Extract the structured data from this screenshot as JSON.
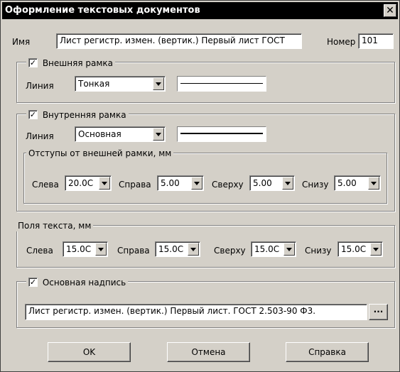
{
  "window": {
    "title": "Оформление текстовых документов",
    "close_glyph": "✕"
  },
  "name_row": {
    "name_label": "Имя",
    "name_value": "Лист регистр. измен. (вертик.) Первый лист ГОСТ",
    "number_label": "Номер",
    "number_value": "101"
  },
  "outer_frame": {
    "checkbox_label": "Внешняя рамка",
    "checked": true,
    "line_label": "Линия",
    "line_value": "Тонкая"
  },
  "inner_frame": {
    "checkbox_label": "Внутренняя рамка",
    "checked": true,
    "line_label": "Линия",
    "line_value": "Основная",
    "offsets": {
      "title": "Отступы от внешней рамки, мм",
      "left_label": "Слева",
      "left_value": "20.0С",
      "right_label": "Справа",
      "right_value": "5.00",
      "top_label": "Сверху",
      "top_value": "5.00",
      "bottom_label": "Снизу",
      "bottom_value": "5.00"
    }
  },
  "text_margins": {
    "title": "Поля текста, мм",
    "left_label": "Слева",
    "left_value": "15.0С",
    "right_label": "Справа",
    "right_value": "15.0С",
    "top_label": "Сверху",
    "top_value": "15.0С",
    "bottom_label": "Снизу",
    "bottom_value": "15.0С"
  },
  "main_inscription": {
    "checkbox_label": "Основная надпись",
    "checked": true,
    "value": "Лист регистр. измен. (вертик.) Первый лист. ГОСТ 2.503-90 Ф3.",
    "browse_label": "···"
  },
  "buttons": {
    "ok": "OK",
    "cancel": "Отмена",
    "help": "Справка"
  },
  "check_glyph": "✓"
}
